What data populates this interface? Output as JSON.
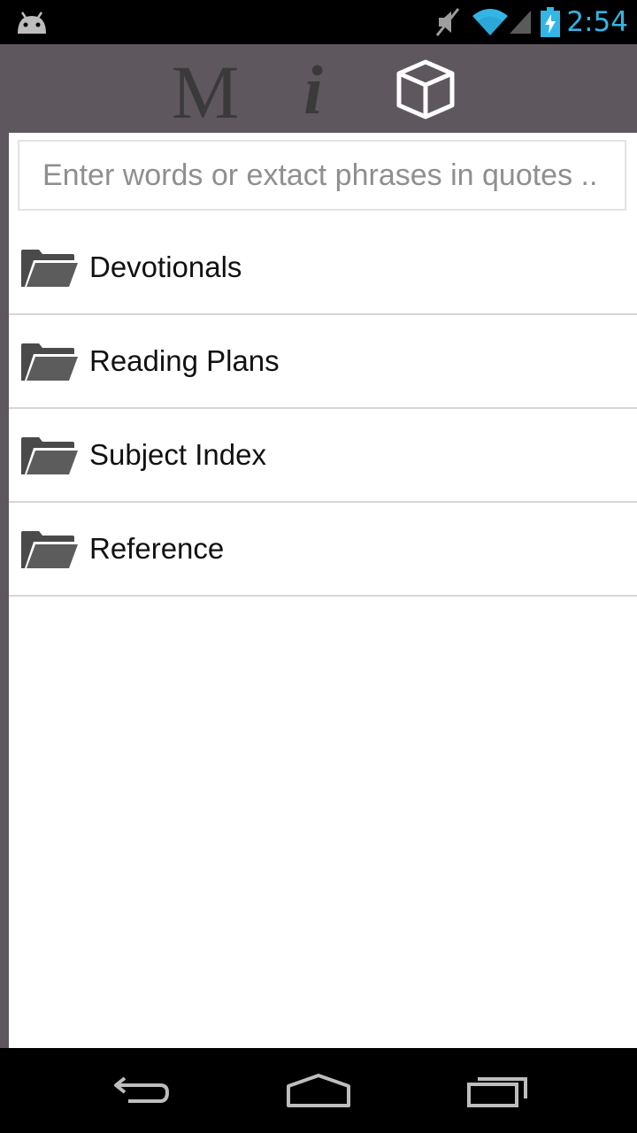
{
  "status_bar": {
    "time": "2:54",
    "accent_color": "#33b5e5",
    "icons": [
      "android-icon",
      "mute-icon",
      "wifi-icon",
      "signal-icon",
      "battery-charging-icon"
    ]
  },
  "toolbar": {
    "m_label": "M",
    "i_label": "i",
    "cube_icon": "cube-icon",
    "background": "#5f575e"
  },
  "search": {
    "placeholder": "Enter words or extact phrases in quotes ..",
    "value": ""
  },
  "list": {
    "items": [
      {
        "label": "Devotionals",
        "icon": "folder-icon"
      },
      {
        "label": "Reading Plans",
        "icon": "folder-icon"
      },
      {
        "label": "Subject Index",
        "icon": "folder-icon"
      },
      {
        "label": "Reference",
        "icon": "folder-icon"
      }
    ]
  },
  "nav_bar": {
    "icons": [
      "back-icon",
      "home-icon",
      "recent-apps-icon"
    ]
  }
}
